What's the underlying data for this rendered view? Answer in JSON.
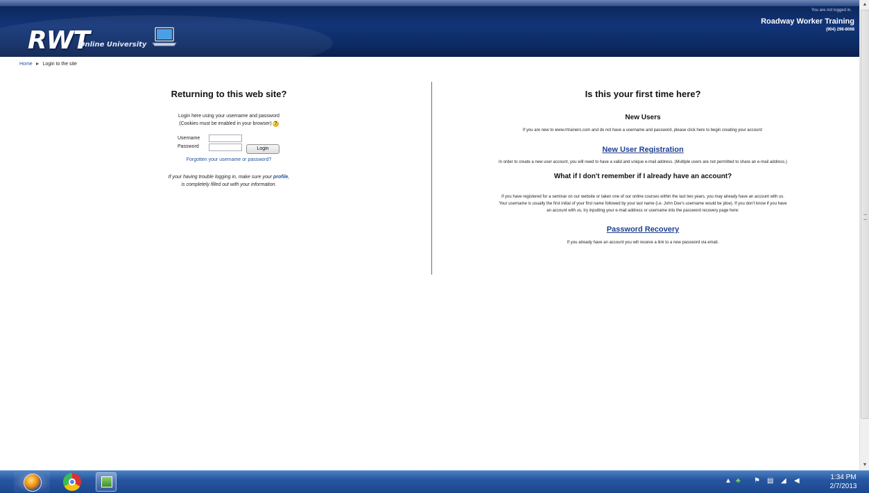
{
  "header": {
    "logo_main": "RWT",
    "logo_sub": "Online University",
    "login_status": "You are not logged in.",
    "company_name": "Roadway Worker Training",
    "company_phone": "(904) 296-8068"
  },
  "breadcrumb": {
    "home": "Home",
    "separator": "►",
    "current": "Login to the site"
  },
  "login": {
    "title": "Returning to this web site?",
    "intro_line1": "Login here using your username and password",
    "intro_line2": "(Cookies must be enabled in your browser)",
    "help_icon": "?",
    "username_label": "Username",
    "username_value": "",
    "password_label": "Password",
    "password_value": "",
    "login_button": "Login",
    "forgot_link": "Forgotten your username or password?",
    "note_line1_pre": "If your having trouble logging in, make sure your",
    "note_profile_link": "profile",
    "note_line1_post": ",",
    "note_line2": "is completely filled out with your information."
  },
  "first_time": {
    "title": "Is this your first time here?",
    "new_users_heading": "New Users",
    "new_users_text": "If you are new to www.rrtrainers.com and do not have a username and password, please click here to begin creating your account:",
    "registration_link": "New User Registration",
    "email_note": "In order to create a new user account, you will need to have a valid and unique e-mail address. (Multiple users are not permitted to share an e-mail address.)",
    "remember_heading": "What if I don't remember if I already have an account?",
    "remember_text_1": "If you have registered for a seminar on our website or taken one of our online courses within the last two years, you may already have an account with us.",
    "remember_text_2": "Your username is usually the first initial of your first name followed by your last name (i.e. John Doe's username would be jdoe).  If you don't know if you have",
    "remember_text_3": "an account with us, try inputting your e-mail address or username into the password recovery page here:",
    "recovery_link": "Password Recovery",
    "recovery_note": "If you already have an account you will receive a link to a new password via email."
  },
  "taskbar": {
    "clock_time": "1:34 PM",
    "clock_date": "2/7/2013"
  }
}
